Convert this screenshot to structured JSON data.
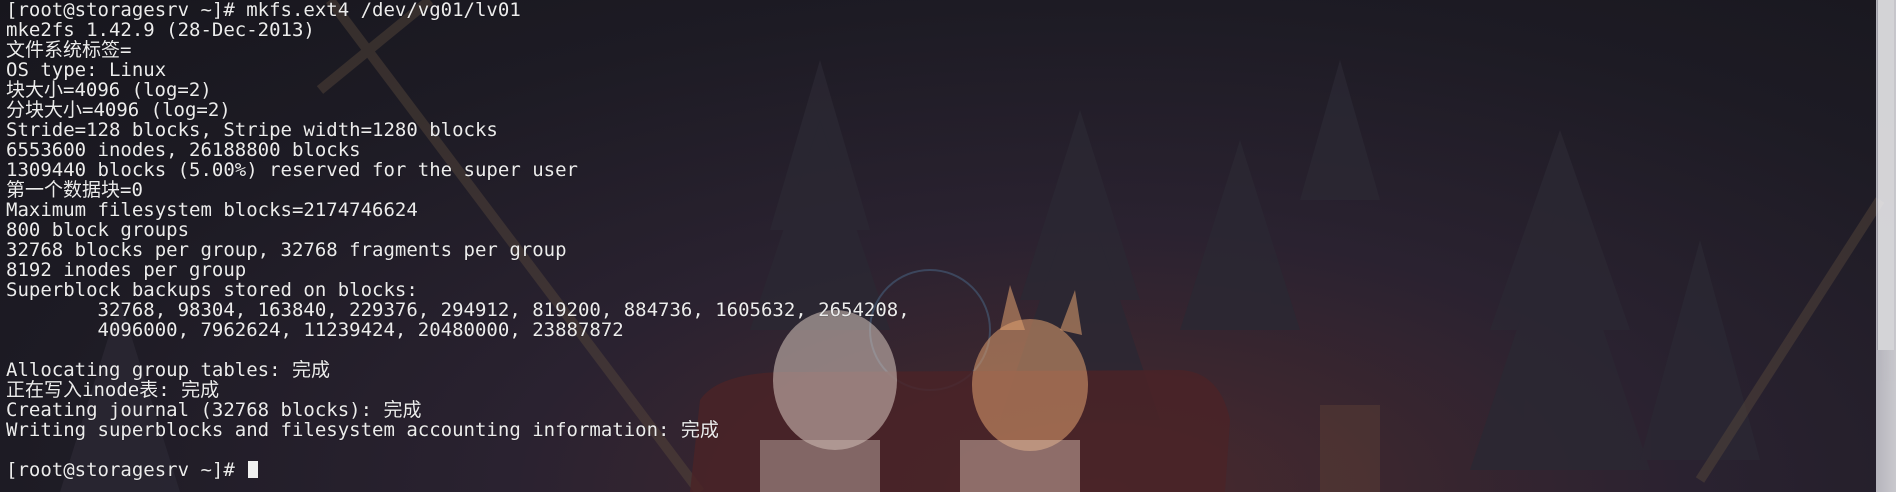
{
  "terminal": {
    "lines": [
      "[root@storagesrv ~]# mkfs.ext4 /dev/vg01/lv01",
      "mke2fs 1.42.9 (28-Dec-2013)",
      "文件系统标签=",
      "OS type: Linux",
      "块大小=4096 (log=2)",
      "分块大小=4096 (log=2)",
      "Stride=128 blocks, Stripe width=1280 blocks",
      "6553600 inodes, 26188800 blocks",
      "1309440 blocks (5.00%) reserved for the super user",
      "第一个数据块=0",
      "Maximum filesystem blocks=2174746624",
      "800 block groups",
      "32768 blocks per group, 32768 fragments per group",
      "8192 inodes per group",
      "Superblock backups stored on blocks:",
      "        32768, 98304, 163840, 229376, 294912, 819200, 884736, 1605632, 2654208,",
      "        4096000, 7962624, 11239424, 20480000, 23887872",
      "",
      "Allocating group tables: 完成",
      "正在写入inode表: 完成",
      "Creating journal (32768 blocks): 完成",
      "Writing superblocks and filesystem accounting information: 完成",
      ""
    ],
    "prompt": "[root@storagesrv ~]# "
  },
  "colors": {
    "text": "#ececec",
    "background": "#1f1b26",
    "cursor": "#f0f0f0"
  }
}
